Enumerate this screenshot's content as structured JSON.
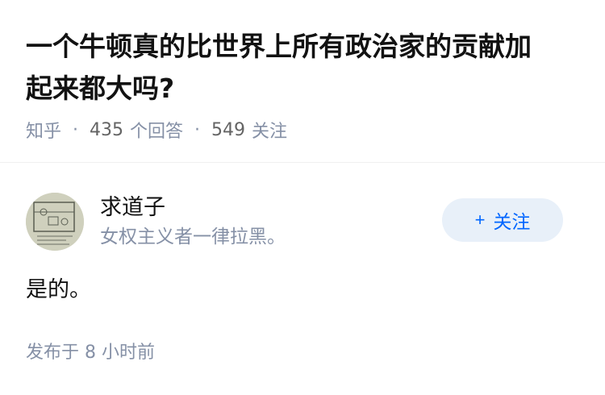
{
  "question": {
    "title_line1": "一个牛顿真的比世界上所有政治家的贡献加",
    "title_line2": "起来都大吗?",
    "source": "知乎",
    "answer_count": "435",
    "answer_label": "个回答",
    "follow_count": "549",
    "follow_label": "关注"
  },
  "answer": {
    "author_name": "求道子",
    "author_bio": "女权主义者一律拉黑。",
    "follow_button": "关注",
    "follow_plus": "+",
    "content": "是的。",
    "publish_label": "发布于",
    "publish_time": "8 小时前"
  },
  "colors": {
    "accent": "#0066ff",
    "button_bg": "#e8f0f9",
    "meta_gray": "#8590a6"
  }
}
